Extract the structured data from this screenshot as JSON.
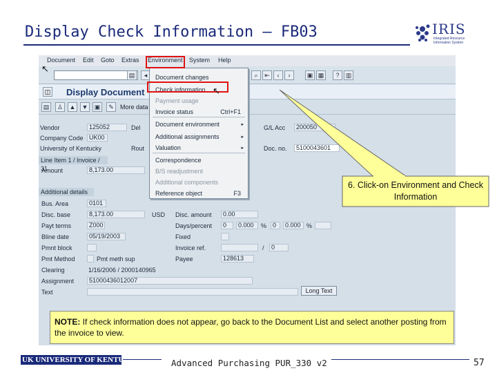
{
  "slide": {
    "title": "Display Check Information – FB03",
    "footer": "Advanced Purchasing PUR_330 v2",
    "page_number": "57",
    "footer_logo": "UK UNIVERSITY OF KENTUCKY"
  },
  "logo": {
    "name": "IRIS",
    "tagline": "Integrated Resource Information System"
  },
  "sap": {
    "menubar": [
      "Document",
      "Edit",
      "Goto",
      "Extras",
      "Environment",
      "System",
      "Help"
    ],
    "screen_title": "Display Document",
    "more_data": "More data",
    "header_fields": {
      "vendor_label": "Vendor",
      "vendor_value": "125052",
      "company_code_label": "Company Code",
      "company_code_value": "UK00",
      "company_name": "University of Kentucky",
      "del_label": "Del",
      "rout_label": "Rout",
      "gl_acc_label": "G/L Acc",
      "gl_acc_value": "200050",
      "doc_no_label": "Doc. no.",
      "doc_no_value": "5100043601"
    },
    "line_item_bar": "Line Item 1 / Invoice / 31",
    "amount_label": "Amount",
    "amount_value": "8,173.00",
    "additional_bar": "Additional details",
    "details": {
      "bus_area_label": "Bus. Area",
      "bus_area_value": "0101",
      "disc_base_label": "Disc. base",
      "disc_base_value": "8,173.00",
      "pay_terms_label": "Payt terms",
      "pay_terms_value": "Z000",
      "bline_date_label": "Bline date",
      "bline_date_value": "05/19/2003",
      "pmnt_block_label": "Pmnt block",
      "pmt_method_label": "Pmt Method",
      "pmt_method_value": "Pmt meth sup",
      "clearing_label": "Clearing",
      "clearing_value": "1/16/2006 / 2000140965",
      "assignment_label": "Assignment",
      "assignment_value": "51000436012007",
      "text_label": "Text",
      "curr_label": "USD",
      "disc_amount_label": "Disc. amount",
      "disc_amount_value": "0.00",
      "days_percent_label": "Days/percent",
      "days_a": "0",
      "days_b": "0.000",
      "days_c": "0",
      "days_d": "0.000",
      "fixed_label": "Fixed",
      "invoice_ref_label": "Invoice ref.",
      "invoice_ref_slash": "/",
      "invoice_ref_value": "0",
      "payee_label": "Payee",
      "payee_value": "128613",
      "pct_sign": "%"
    },
    "long_text_button": "Long Text"
  },
  "dropdown": {
    "items": [
      {
        "label": "Document changes",
        "disabled": false,
        "arrow": false,
        "key": ""
      },
      {
        "label": "Check information",
        "disabled": false,
        "arrow": false,
        "key": ""
      },
      {
        "label": "Payment usage",
        "disabled": true,
        "arrow": false,
        "key": ""
      },
      {
        "label": "Invoice status",
        "disabled": false,
        "arrow": false,
        "key": "Ctrl+F1"
      },
      {
        "label": "Document environment",
        "disabled": false,
        "arrow": true,
        "key": ""
      },
      {
        "label": "Additional assignments",
        "disabled": false,
        "arrow": true,
        "key": ""
      },
      {
        "label": "Valuation",
        "disabled": false,
        "arrow": true,
        "key": ""
      },
      {
        "label": "Correspondence",
        "disabled": false,
        "arrow": false,
        "key": ""
      },
      {
        "label": "B/S readjustment",
        "disabled": true,
        "arrow": false,
        "key": ""
      },
      {
        "label": "Additional components",
        "disabled": true,
        "arrow": false,
        "key": ""
      },
      {
        "label": "Reference object",
        "disabled": false,
        "arrow": false,
        "key": "F3"
      }
    ]
  },
  "callout": {
    "text": "6. Click-on Environment and Check Information"
  },
  "note": {
    "label": "NOTE:",
    "text": " If check information does not appear, go back to the Document List and select another posting from the invoice to view."
  },
  "colors": {
    "highlight": "#e01010",
    "callout_fill": "#ffff99",
    "title_blue": "#1a2a7a"
  }
}
